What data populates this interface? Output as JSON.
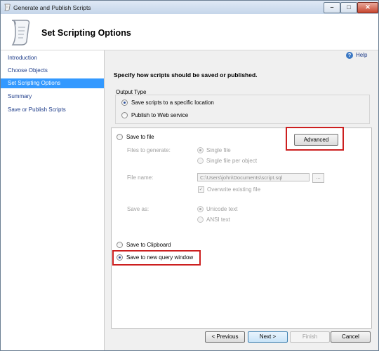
{
  "window": {
    "title": "Generate and Publish Scripts"
  },
  "header": {
    "title": "Set Scripting Options"
  },
  "sidebar": {
    "items": [
      {
        "label": "Introduction"
      },
      {
        "label": "Choose Objects"
      },
      {
        "label": "Set Scripting Options",
        "active": true
      },
      {
        "label": "Summary"
      },
      {
        "label": "Save or Publish Scripts"
      }
    ]
  },
  "help": {
    "label": "Help"
  },
  "main": {
    "instruction": "Specify how scripts should be saved or published.",
    "output_type": {
      "label": "Output Type",
      "save_to_location": "Save scripts to a specific location",
      "publish_web": "Publish to Web service",
      "selected": "save_to_location"
    },
    "save_to_file": {
      "label": "Save to file",
      "advanced_button": "Advanced",
      "files_to_generate_label": "Files to generate:",
      "single_file": "Single file",
      "single_file_per_object": "Single file per object",
      "file_name_label": "File name:",
      "file_name_value": "C:\\Users\\john\\Documents\\script.sql",
      "browse_button": "...",
      "overwrite_label": "Overwrite existing file",
      "overwrite_checked": true,
      "save_as_label": "Save as:",
      "unicode_text": "Unicode text",
      "ansi_text": "ANSI text"
    },
    "save_to_clipboard": "Save to Clipboard",
    "save_to_query_window": "Save to new query window",
    "selected_destination": "save_to_query_window"
  },
  "footer": {
    "previous": "< Previous",
    "next": "Next >",
    "finish": "Finish",
    "cancel": "Cancel"
  },
  "colors": {
    "highlight_box": "#cc1f1f",
    "active_nav_bg": "#3399ff",
    "nav_text": "#1f3d8a"
  },
  "icons": {
    "app": "scroll-icon",
    "help": "help-icon",
    "minimize": "minimize-icon",
    "maximize": "maximize-icon",
    "close": "close-icon"
  }
}
